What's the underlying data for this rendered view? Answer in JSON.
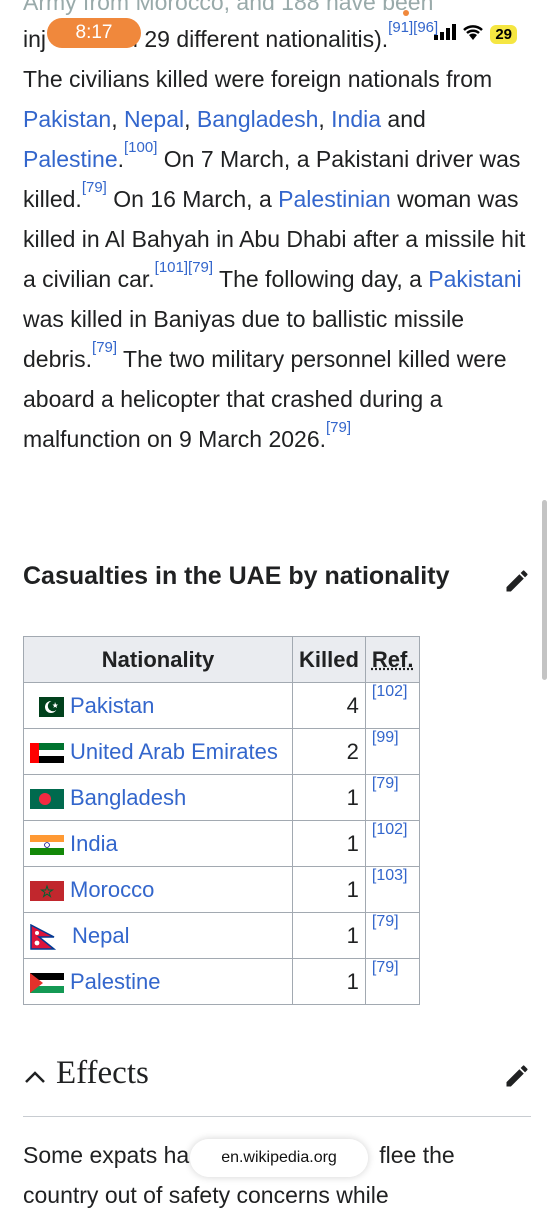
{
  "status": {
    "time": "8:17",
    "battery": "29"
  },
  "article": {
    "top_cut": "Army from Morocco, and 188 have been",
    "line1_start": "inj",
    "line1_mid": "om 29 different nationaliti",
    "line1_end": "s).",
    "line1_refs": "[91][96]",
    "para1": {
      "t1": "The civilians killed were foreign nationals from ",
      "l_pakistan": "Pakistan",
      "s1": ", ",
      "l_nepal": "Nepal",
      "s2": ", ",
      "l_bangladesh": "Bangladesh",
      "s3": ", ",
      "l_india": "India",
      "s4": " and ",
      "l_palestine": "Palestine",
      "s5": ".",
      "r100": "[100]",
      "t2": " On 7 March, a Pakistani driver was killed.",
      "r79a": "[79]",
      "t3": " On 16 March, a ",
      "l_palestinian": "Palestinian",
      "t4": " woman was killed in Al Bahyah in Abu Dhabi after a missile hit a civilian car.",
      "r101": "[101][79]",
      "t5": " The following day, a ",
      "l_pakistani": "Pakistani",
      "t6": " was killed in Baniyas due to ballistic missile debris.",
      "r79b": "[79]",
      "t7": " The two military personnel killed were aboard a helicopter that crashed during a malfunction on 9 March 2026.",
      "r79c": "[79]"
    },
    "section_title": "Casualties in the UAE by nationality",
    "table": {
      "headers": [
        "Nationality",
        "Killed",
        "Ref."
      ],
      "rows": [
        {
          "nationality": "Pakistan",
          "killed": "4",
          "ref": "[102]"
        },
        {
          "nationality": "United Arab Emirates",
          "killed": "2",
          "ref": "[99]"
        },
        {
          "nationality": "Bangladesh",
          "killed": "1",
          "ref": "[79]"
        },
        {
          "nationality": "India",
          "killed": "1",
          "ref": "[102]"
        },
        {
          "nationality": "Morocco",
          "killed": "1",
          "ref": "[103]"
        },
        {
          "nationality": "Nepal",
          "killed": "1",
          "ref": "[79]"
        },
        {
          "nationality": "Palestine",
          "killed": "1",
          "ref": "[79]"
        }
      ]
    },
    "effects_title": "Effects",
    "para2_a": "Some expats ha",
    "para2_b": "flee the",
    "para2_line2": "country out of safety concerns while"
  },
  "browser": {
    "url": "en.wikipedia.org"
  },
  "colors": {
    "link": "#3366cc",
    "status_pill": "#f0883c",
    "battery": "#f5e642"
  }
}
